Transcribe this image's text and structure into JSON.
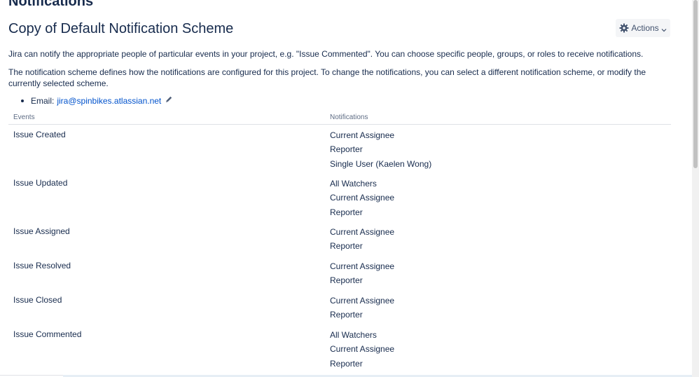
{
  "page": {
    "section_title": "Notifications",
    "scheme_title": "Copy of Default Notification Scheme",
    "actions_label": "Actions",
    "description_1": "Jira can notify the appropriate people of particular events in your project, e.g. \"Issue Commented\". You can choose specific people, groups, or roles to receive notifications.",
    "description_2": "The notification scheme defines how the notifications are configured for this project. To change the notifications, you can select a different notification scheme, or modify the currently selected scheme.",
    "email_label": "Email:",
    "email_value": "jira@spinbikes.atlassian.net"
  },
  "table": {
    "headers": {
      "events": "Events",
      "notifications": "Notifications"
    },
    "rows": [
      {
        "event": "Issue Created",
        "notifications": [
          "Current Assignee",
          "Reporter",
          "Single User (Kaelen Wong)"
        ]
      },
      {
        "event": "Issue Updated",
        "notifications": [
          "All Watchers",
          "Current Assignee",
          "Reporter"
        ]
      },
      {
        "event": "Issue Assigned",
        "notifications": [
          "Current Assignee",
          "Reporter"
        ]
      },
      {
        "event": "Issue Resolved",
        "notifications": [
          "Current Assignee",
          "Reporter"
        ]
      },
      {
        "event": "Issue Closed",
        "notifications": [
          "Current Assignee",
          "Reporter"
        ]
      },
      {
        "event": "Issue Commented",
        "notifications": [
          "All Watchers",
          "Current Assignee",
          "Reporter"
        ]
      }
    ]
  },
  "icons": {
    "actions": "gear-icon",
    "actions_dropdown": "chevron-down-icon",
    "edit_email": "pencil-icon"
  },
  "colors": {
    "text": "#172b4d",
    "link": "#0052cc",
    "header_text": "#5e6c84",
    "button_bg": "#f4f5f7"
  }
}
